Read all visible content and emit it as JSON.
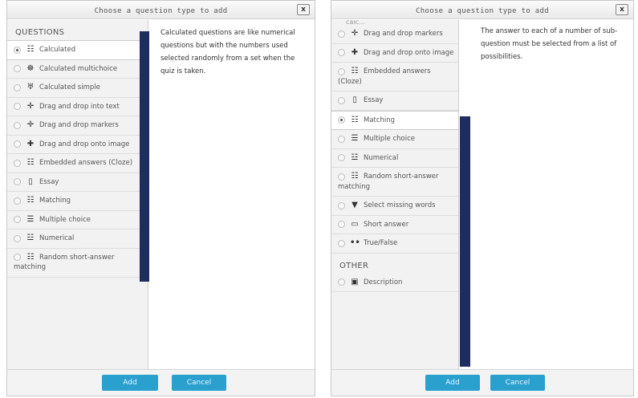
{
  "left_dialog": {
    "title": "Choose a question type to add",
    "close_label": "x",
    "section_questions": "QUESTIONS",
    "items": [
      {
        "label": "Calculated",
        "icon": "calculated-icon",
        "glyph": "☷",
        "selected": true
      },
      {
        "label": "Calculated multichoice",
        "icon": "calculated-multichoice-icon",
        "glyph": "☸",
        "selected": false
      },
      {
        "label": "Calculated simple",
        "icon": "calculated-simple-icon",
        "glyph": "♅",
        "selected": false
      },
      {
        "label": "Drag and drop into text",
        "icon": "drag-drop-text-icon",
        "glyph": "✛",
        "selected": false
      },
      {
        "label": "Drag and drop markers",
        "icon": "drag-drop-markers-icon",
        "glyph": "✛",
        "selected": false
      },
      {
        "label": "Drag and drop onto image",
        "icon": "drag-drop-image-icon",
        "glyph": "✚",
        "selected": false
      },
      {
        "label": "Embedded answers (Cloze)",
        "icon": "cloze-icon",
        "glyph": "☷",
        "selected": false
      },
      {
        "label": "Essay",
        "icon": "essay-icon",
        "glyph": "▯",
        "selected": false
      },
      {
        "label": "Matching",
        "icon": "matching-icon",
        "glyph": "☷",
        "selected": false
      },
      {
        "label": "Multiple choice",
        "icon": "multiple-choice-icon",
        "glyph": "☰",
        "selected": false
      },
      {
        "label": "Numerical",
        "icon": "numerical-icon",
        "glyph": "☳",
        "selected": false
      },
      {
        "label": "Random short-answer matching",
        "icon": "random-short-answer-icon",
        "glyph": "☷",
        "selected": false
      }
    ],
    "description": "Calculated questions are like numerical questions but with the numbers used selected randomly from a set when the quiz is taken.",
    "add_label": "Add",
    "cancel_label": "Cancel"
  },
  "right_dialog": {
    "title": "Choose a question type to add",
    "close_label": "x",
    "cut_text": "calc...",
    "items": [
      {
        "label": "Drag and drop markers",
        "icon": "drag-drop-markers-icon",
        "glyph": "✛",
        "selected": false
      },
      {
        "label": "Drag and drop onto image",
        "icon": "drag-drop-image-icon",
        "glyph": "✚",
        "selected": false
      },
      {
        "label": "Embedded answers (Cloze)",
        "icon": "cloze-icon",
        "glyph": "☷",
        "selected": false
      },
      {
        "label": "Essay",
        "icon": "essay-icon",
        "glyph": "▯",
        "selected": false
      },
      {
        "label": "Matching",
        "icon": "matching-icon",
        "glyph": "☷",
        "selected": true
      },
      {
        "label": "Multiple choice",
        "icon": "multiple-choice-icon",
        "glyph": "☰",
        "selected": false
      },
      {
        "label": "Numerical",
        "icon": "numerical-icon",
        "glyph": "☳",
        "selected": false
      },
      {
        "label": "Random short-answer matching",
        "icon": "random-short-answer-icon",
        "glyph": "☷",
        "selected": false
      },
      {
        "label": "Select missing words",
        "icon": "select-missing-words-icon",
        "glyph": "▼",
        "selected": false
      },
      {
        "label": "Short answer",
        "icon": "short-answer-icon",
        "glyph": "▭",
        "selected": false
      },
      {
        "label": "True/False",
        "icon": "true-false-icon",
        "glyph": "••",
        "selected": false
      }
    ],
    "section_other": "OTHER",
    "other_items": [
      {
        "label": "Description",
        "icon": "description-icon",
        "glyph": "▣",
        "selected": false
      }
    ],
    "description": "The answer to each of a number of sub-question must be selected from a list of possibilities.",
    "add_label": "Add",
    "cancel_label": "Cancel"
  },
  "colors": {
    "accent": "#2aa0cf",
    "scrollbar": "#1e2c5e",
    "list_bg": "#f2f2f2"
  }
}
